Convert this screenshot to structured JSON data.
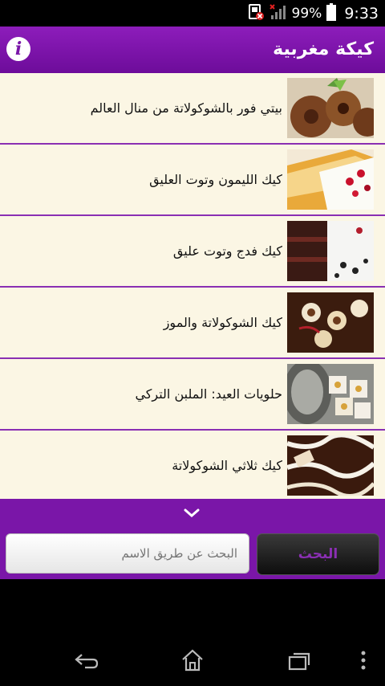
{
  "status_bar": {
    "battery_percent": "99%",
    "time": "9:33"
  },
  "app_bar": {
    "title": "كيكة مغربية",
    "info_label": "i"
  },
  "recipes": [
    {
      "title": "بيتي فور بالشوكولاتة من منال العالم"
    },
    {
      "title": "كيك الليمون وتوت العليق"
    },
    {
      "title": "كيك فدج وتوت عليق"
    },
    {
      "title": "كيك الشوكولاتة والموز"
    },
    {
      "title": "حلويات العيد: الملبن التركي"
    },
    {
      "title": "كيك ثلاثي الشوكولاتة"
    }
  ],
  "search": {
    "placeholder": "البحث عن طريق الاسم",
    "button_label": "البحث"
  },
  "colors": {
    "accent": "#7a16a8",
    "list_bg": "#fbf6e4"
  }
}
